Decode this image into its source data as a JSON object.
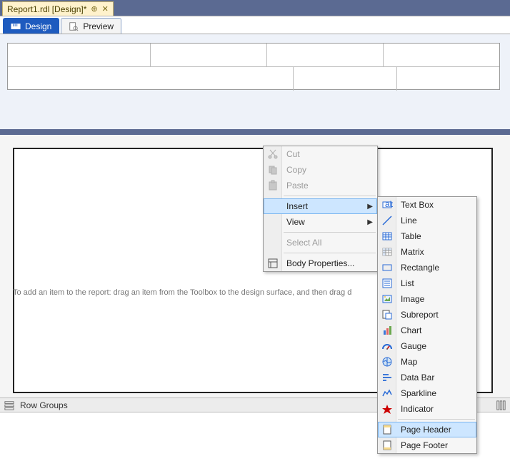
{
  "doc_tab": {
    "title": "Report1.rdl [Design]*"
  },
  "mode_tabs": {
    "design": "Design",
    "preview": "Preview"
  },
  "design_hint": "To add an item to the report: drag an item from the Toolbox to the design surface, and then drag d",
  "rowgroups": {
    "label": "Row Groups"
  },
  "ctx": {
    "cut": "Cut",
    "copy": "Copy",
    "paste": "Paste",
    "insert": "Insert",
    "view": "View",
    "select_all": "Select All",
    "body_props": "Body Properties..."
  },
  "insert_items": {
    "textbox": "Text Box",
    "line": "Line",
    "table": "Table",
    "matrix": "Matrix",
    "rectangle": "Rectangle",
    "list": "List",
    "image": "Image",
    "subreport": "Subreport",
    "chart": "Chart",
    "gauge": "Gauge",
    "map": "Map",
    "databar": "Data Bar",
    "sparkline": "Sparkline",
    "indicator": "Indicator",
    "page_header": "Page Header",
    "page_footer": "Page Footer"
  }
}
